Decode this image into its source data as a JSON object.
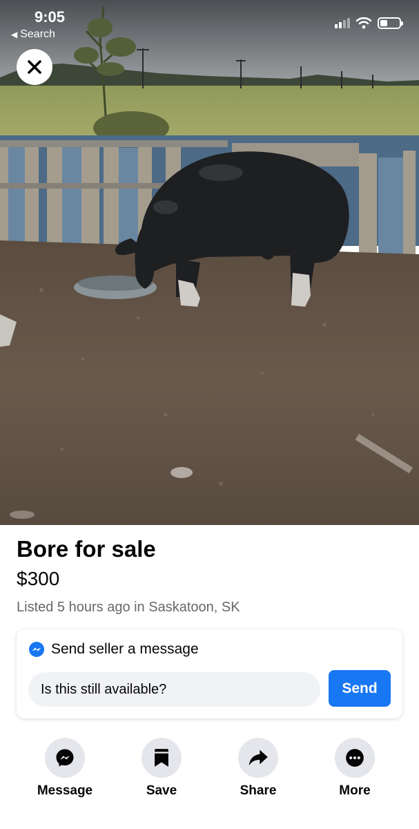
{
  "status_bar": {
    "time": "9:05",
    "back_label": "Search"
  },
  "photo": {
    "icon": "close-icon"
  },
  "listing": {
    "title": "Bore for sale",
    "price": "$300",
    "meta": "Listed 5 hours ago in Saskatoon, SK"
  },
  "message_card": {
    "heading": "Send seller a message",
    "input_value": "Is this still available?",
    "send_label": "Send",
    "icon": "messenger-icon"
  },
  "actions": [
    {
      "label": "Message",
      "icon": "messenger-icon"
    },
    {
      "label": "Save",
      "icon": "bookmark-icon"
    },
    {
      "label": "Share",
      "icon": "share-arrow-icon"
    },
    {
      "label": "More",
      "icon": "more-dots-icon"
    }
  ],
  "colors": {
    "accent": "#1877f2",
    "secondary_text": "#65676b",
    "action_circle": "#e4e6eb",
    "input_bg": "#f0f2f5"
  }
}
